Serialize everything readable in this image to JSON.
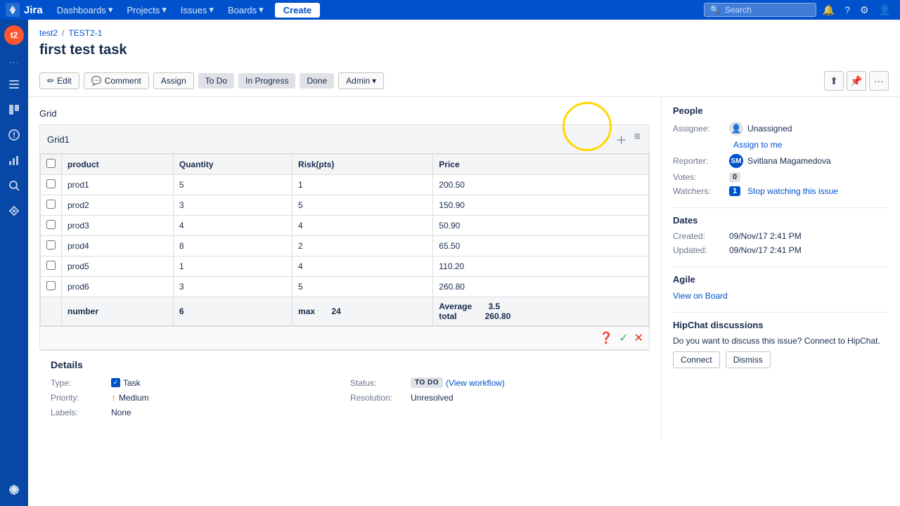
{
  "topnav": {
    "logo_text": "Jira",
    "dashboards_label": "Dashboards",
    "projects_label": "Projects",
    "issues_label": "Issues",
    "boards_label": "Boards",
    "create_label": "Create",
    "search_placeholder": "Search"
  },
  "breadcrumb": {
    "project": "test2",
    "issue_id": "TEST2-1"
  },
  "issue": {
    "title": "first test task"
  },
  "actions": {
    "edit": "Edit",
    "comment": "Comment",
    "assign": "Assign",
    "todo": "To Do",
    "in_progress": "In Progress",
    "done": "Done",
    "admin": "Admin"
  },
  "grid": {
    "label": "Grid",
    "grid1_title": "Grid1",
    "columns": [
      "",
      "product",
      "Quantity",
      "Risk(pts)",
      "Price"
    ],
    "rows": [
      {
        "product": "prod1",
        "quantity": "5",
        "risk": "1",
        "price": "200.50"
      },
      {
        "product": "prod2",
        "quantity": "3",
        "risk": "5",
        "price": "150.90"
      },
      {
        "product": "prod3",
        "quantity": "4",
        "risk": "4",
        "price": "50.90"
      },
      {
        "product": "prod4",
        "quantity": "8",
        "risk": "2",
        "price": "65.50"
      },
      {
        "product": "prod5",
        "quantity": "1",
        "risk": "4",
        "price": "110.20"
      },
      {
        "product": "prod6",
        "quantity": "3",
        "risk": "5",
        "price": "260.80"
      }
    ],
    "footer": {
      "number_label": "number",
      "number_val": "6",
      "max_label": "max",
      "max_val": "24",
      "average_label": "Average",
      "average_val": "3.5",
      "total_label": "total",
      "total_val": "260.80"
    }
  },
  "people": {
    "section_title": "People",
    "assignee_label": "Assignee:",
    "assignee_value": "Unassigned",
    "assign_to_me": "Assign to me",
    "reporter_label": "Reporter:",
    "reporter_value": "Svitlana Magamedova",
    "votes_label": "Votes:",
    "votes_count": "0",
    "watchers_label": "Watchers:",
    "watchers_count": "1",
    "stop_watching": "Stop watching this issue"
  },
  "dates": {
    "section_title": "Dates",
    "created_label": "Created:",
    "created_value": "09/Nov/17 2:41 PM",
    "updated_label": "Updated:",
    "updated_value": "09/Nov/17 2:41 PM"
  },
  "agile": {
    "section_title": "Agile",
    "view_on_board": "View on Board"
  },
  "hipchat": {
    "section_title": "HipChat discussions",
    "message": "Do you want to discuss this issue? Connect to HipChat.",
    "connect_btn": "Connect",
    "dismiss_btn": "Dismiss"
  },
  "details": {
    "section_title": "Details",
    "type_label": "Type:",
    "type_value": "Task",
    "status_label": "Status:",
    "status_value": "TO DO",
    "view_workflow": "View workflow",
    "priority_label": "Priority:",
    "priority_value": "Medium",
    "resolution_label": "Resolution:",
    "resolution_value": "Unresolved",
    "labels_label": "Labels:",
    "labels_value": "None"
  }
}
